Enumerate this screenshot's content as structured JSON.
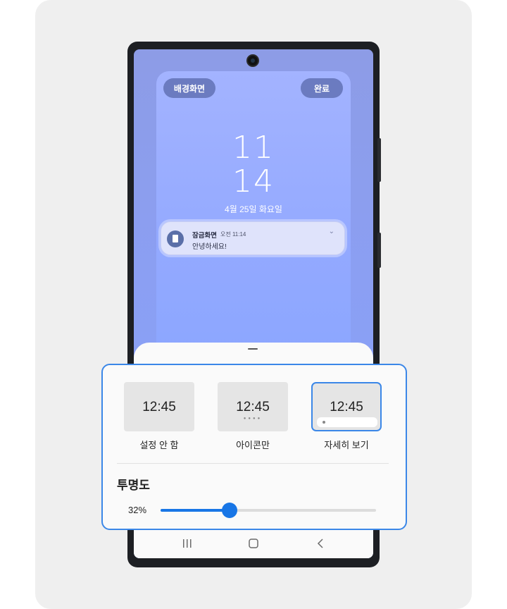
{
  "lock_preview": {
    "wallpaper_button": "배경화면",
    "done_button": "완료",
    "clock_hour": "11",
    "clock_minute": "14",
    "date": "4월 25일 화요일",
    "notification": {
      "app": "잠금화면",
      "time": "오전 11:14",
      "message": "안녕하세요!"
    }
  },
  "notification_styles": {
    "options": [
      {
        "time": "12:45",
        "label": "설정 안 함",
        "selected": false
      },
      {
        "time": "12:45",
        "label": "아이콘만",
        "selected": false
      },
      {
        "time": "12:45",
        "label": "자세히 보기",
        "selected": true
      }
    ]
  },
  "transparency": {
    "title": "투명도",
    "value_label": "32%",
    "value": 0.32
  },
  "colors": {
    "accent": "#1876e6",
    "highlight_border": "#3b87e8"
  },
  "nav": {
    "recents_icon": "recents-icon",
    "home_icon": "home-icon",
    "back_icon": "back-icon"
  }
}
